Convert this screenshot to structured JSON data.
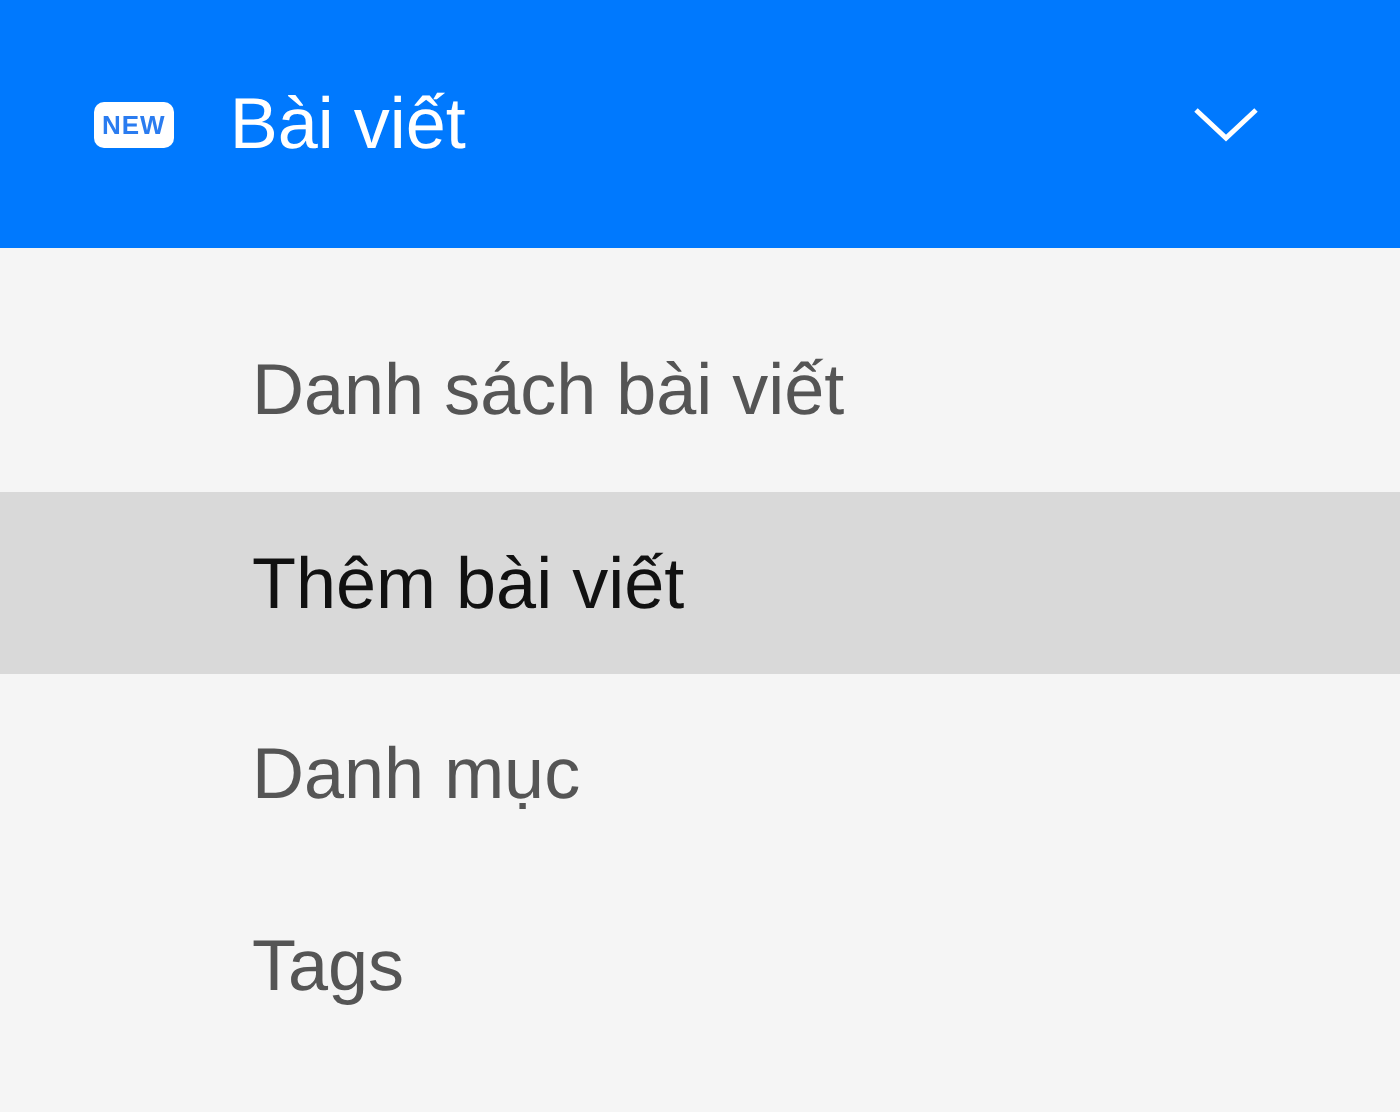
{
  "menu": {
    "badge": "NEW",
    "title": "Bài viết",
    "expanded": true,
    "items": [
      {
        "label": "Danh sách bài viết",
        "selected": false
      },
      {
        "label": "Thêm bài viết",
        "selected": true
      },
      {
        "label": "Danh mục",
        "selected": false
      },
      {
        "label": "Tags",
        "selected": false
      }
    ]
  }
}
